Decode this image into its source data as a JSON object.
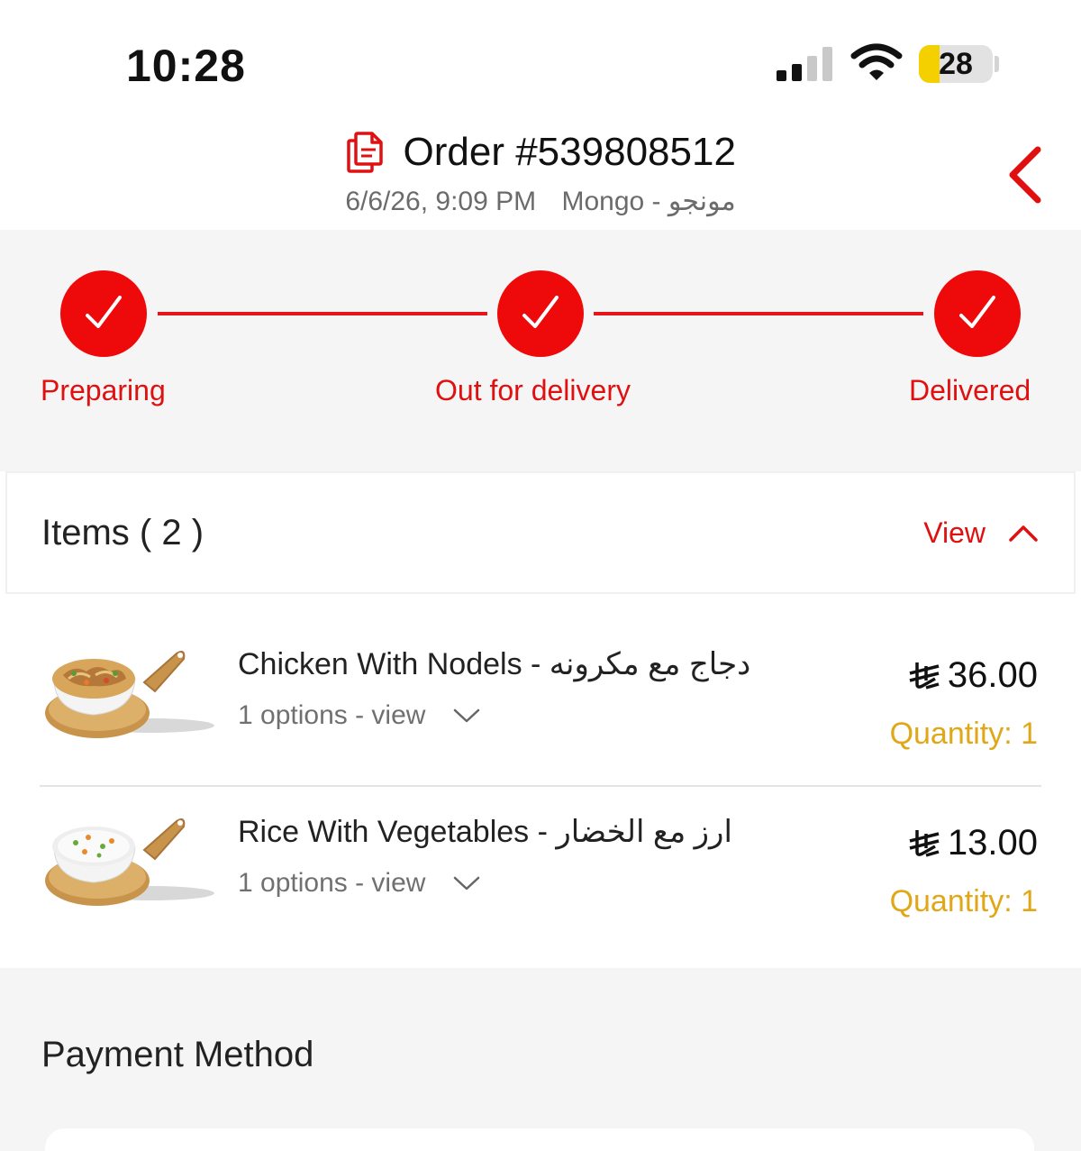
{
  "status_bar": {
    "time": "10:28",
    "battery": "28",
    "battery_level": 0.28
  },
  "header": {
    "order_title": "Order #539808512",
    "date_time": "6/6/26, 9:09 PM",
    "store": "Mongo - مونجو",
    "accent_color": "#e01010"
  },
  "progress": {
    "steps": [
      {
        "label": "Preparing",
        "done": true
      },
      {
        "label": "Out for delivery",
        "done": true
      },
      {
        "label": "Delivered",
        "done": true
      }
    ]
  },
  "items_section": {
    "title": "Items ( 2 )",
    "toggle_label": "View",
    "items": [
      {
        "name": "Chicken With Nodels - دجاج مع مكرونه",
        "options": "1 options - view",
        "price": "36.00",
        "quantity": "Quantity: 1"
      },
      {
        "name": "Rice With Vegetables - ارز مع الخضار",
        "options": "1 options - view",
        "price": "13.00",
        "quantity": "Quantity: 1"
      }
    ]
  },
  "payment": {
    "title": "Payment Method"
  },
  "icons": {
    "order": "order-document-icon",
    "back": "chevron-left-icon",
    "check": "checkmark-icon",
    "toggle": "chevron-up-icon",
    "options": "chevron-down-icon",
    "currency": "saudi-riyal-icon"
  }
}
